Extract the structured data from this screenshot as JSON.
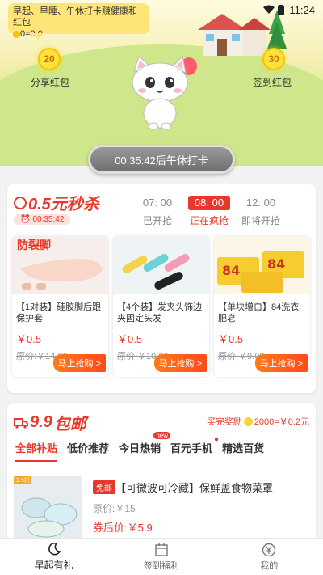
{
  "status_bar": {
    "time": "11:24"
  },
  "hero": {
    "bubble_text": "早起、早睡、午休打卡赚健康和红包",
    "bubble_amount": "0=0.0",
    "left_coin": "20",
    "right_coin": "30",
    "left_label": "分享红包",
    "right_label": "签到红包",
    "punch_button": "00:35:42后午休打卡"
  },
  "flash_sale": {
    "logo_prefix": "0.5元",
    "logo_suffix": "秒杀",
    "countdown": "00:35:42",
    "slots": [
      {
        "time": "07: 00",
        "status": "已开抢",
        "active": false
      },
      {
        "time": "08: 00",
        "status": "正在疯抢",
        "active": true
      },
      {
        "time": "12: 00",
        "status": "即将开抢",
        "active": false
      }
    ],
    "products": [
      {
        "name": "【1对装】硅胶脚后跟保护套",
        "price": "￥0.5",
        "original": "原价:￥14.00",
        "button": "马上抢购 >",
        "image_text": "防裂脚"
      },
      {
        "name": "【4个装】发夹头饰边夹固定头发",
        "price": "￥0.5",
        "original": "原价:￥10.00",
        "button": "马上抢购 >"
      },
      {
        "name": "【单块增白】84洗衣肥皂",
        "price": "￥0.5",
        "original": "原价:￥9.00",
        "button": "马上抢购 >",
        "image_text": "84"
      }
    ]
  },
  "nine_nine": {
    "logo_prefix": "9.9",
    "logo_suffix": "包邮",
    "reward_prefix": "买完奖励",
    "reward_value": "2000=￥0.2元",
    "tabs": [
      {
        "label": "全部补贴",
        "active": true
      },
      {
        "label": "低价推荐",
        "active": false
      },
      {
        "label": "今日热销",
        "active": false,
        "badge": "new"
      },
      {
        "label": "百元手机",
        "active": false,
        "dot": true
      },
      {
        "label": "精选百货",
        "active": false
      }
    ],
    "item": {
      "image_badge": "3.9折",
      "tag": "免邮",
      "title": "【可微波可冷藏】保鲜盖食物菜罩",
      "original": "原价:￥15",
      "price": "券后价:￥5.9"
    }
  },
  "bottom_nav": [
    {
      "label": "早起有礼",
      "active": true
    },
    {
      "label": "签到福利",
      "active": false
    },
    {
      "label": "我的",
      "active": false
    }
  ],
  "colors": {
    "accent": "#e8382b",
    "button_orange": "#ff5a1a",
    "coin_yellow": "#ffe23d"
  }
}
